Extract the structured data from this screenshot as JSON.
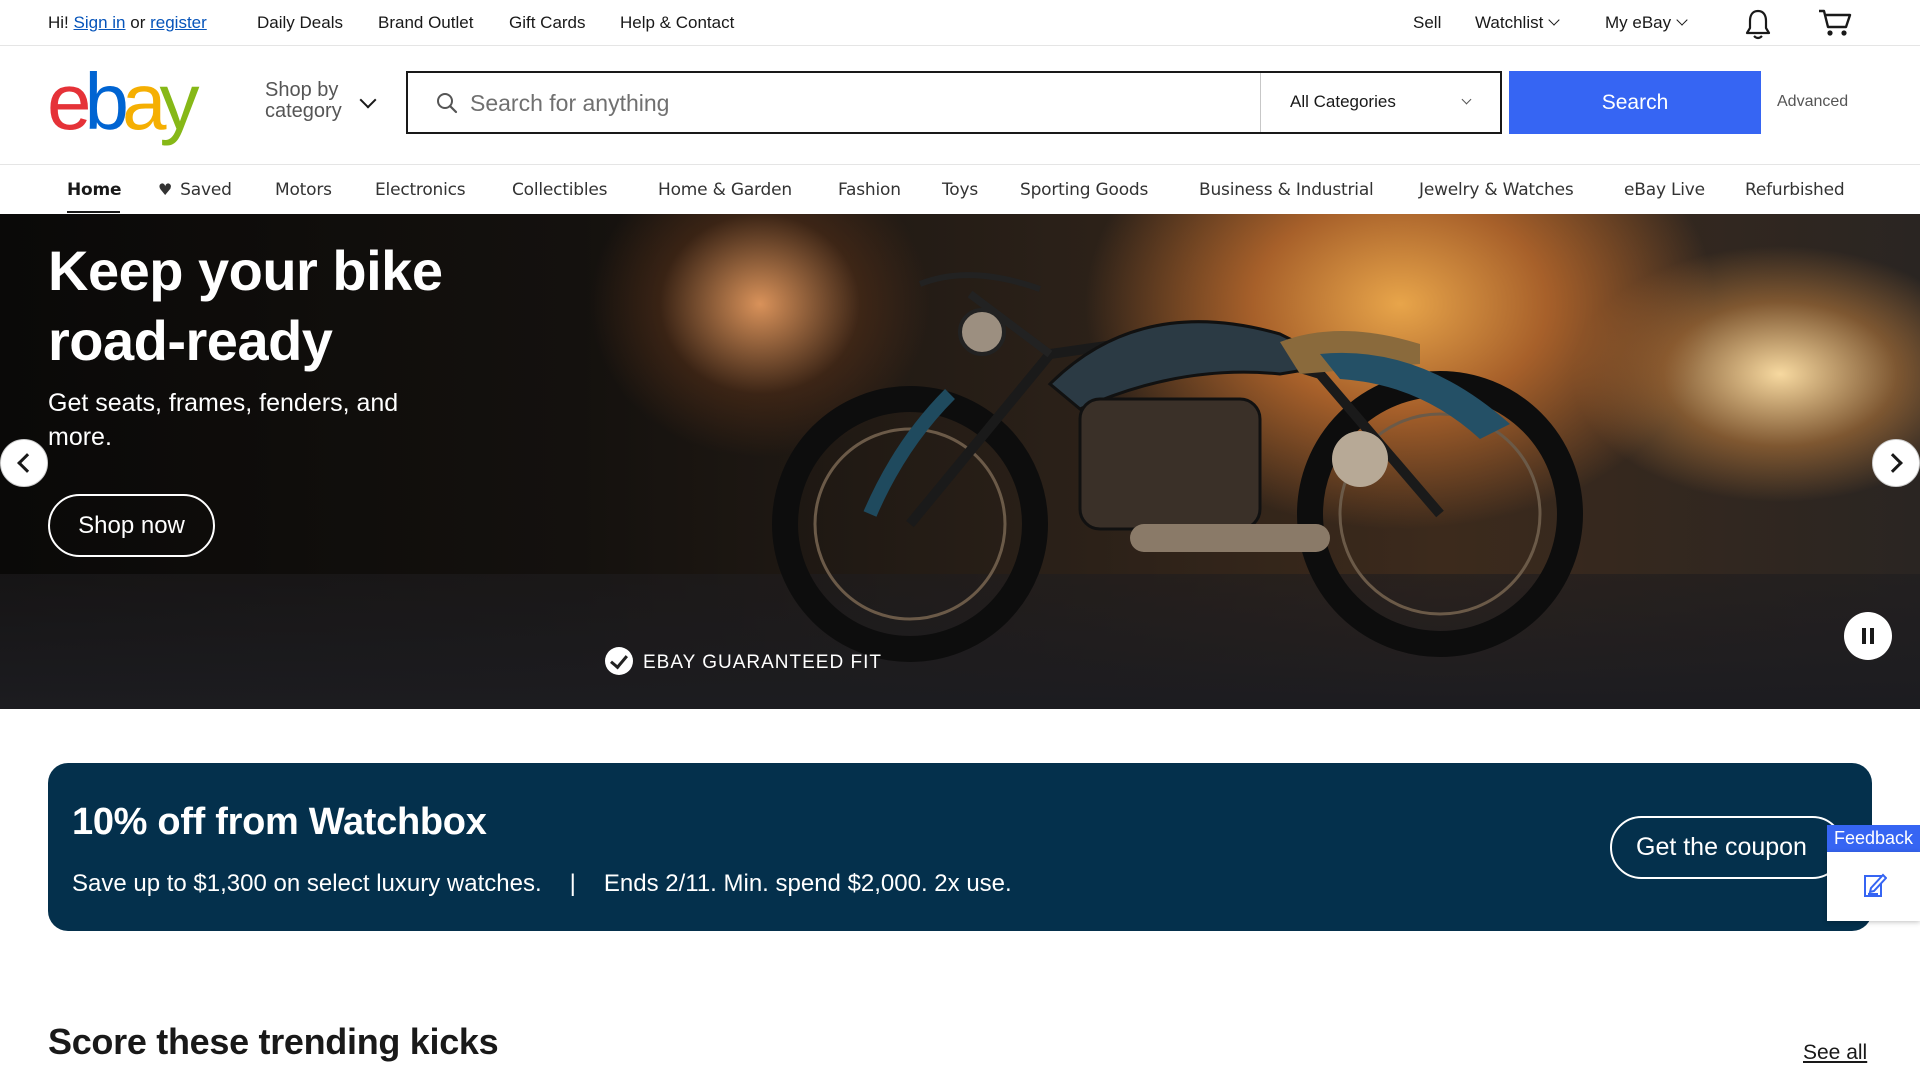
{
  "topbar": {
    "greeting": "Hi!",
    "sign_in": "Sign in",
    "or": "or",
    "register": "register",
    "links": [
      "Daily Deals",
      "Brand Outlet",
      "Gift Cards",
      "Help & Contact"
    ],
    "sell": "Sell",
    "watchlist": "Watchlist",
    "my_ebay": "My eBay",
    "icons": [
      "bell-icon",
      "cart-icon"
    ]
  },
  "header": {
    "logo": [
      "e",
      "b",
      "a",
      "y"
    ],
    "shop_by_line1": "Shop by",
    "shop_by_line2": "category",
    "search_placeholder": "Search for anything",
    "category_selected": "All Categories",
    "search_button": "Search",
    "advanced": "Advanced"
  },
  "catnav": {
    "items": [
      "Home",
      "Saved",
      "Motors",
      "Electronics",
      "Collectibles",
      "Home & Garden",
      "Fashion",
      "Toys",
      "Sporting Goods",
      "Business & Industrial",
      "Jewelry & Watches",
      "eBay Live",
      "Refurbished"
    ],
    "active": "Home"
  },
  "hero": {
    "title": "Keep your bike road-ready",
    "subtitle": "Get seats, frames, fenders, and more.",
    "cta": "Shop now",
    "badge": "EBAY GUARANTEED FIT"
  },
  "promo": {
    "title": "10% off from Watchbox",
    "text_left": "Save up to $1,300 on select luxury watches.",
    "separator": "|",
    "text_right": "Ends 2/11. Min. spend $2,000. 2x use.",
    "cta": "Get the coupon"
  },
  "feedback": {
    "label": "Feedback"
  },
  "trending": {
    "title": "Score these trending kicks",
    "see_all": "See all"
  },
  "colors": {
    "accent_blue": "#3665f3",
    "promo_bg": "#04304c",
    "link": "#0654ba"
  }
}
